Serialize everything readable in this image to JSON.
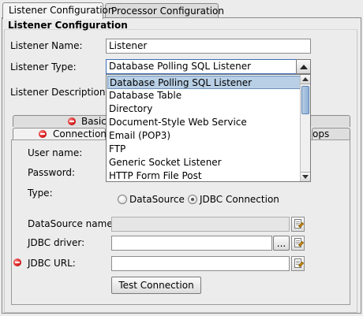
{
  "tabs": [
    {
      "label": "Listener Configuration"
    },
    {
      "label": "Processor Configuration"
    }
  ],
  "group_title": "Listener Configuration",
  "listener_name": {
    "label": "Listener Name:",
    "value": "Listener"
  },
  "listener_type": {
    "label": "Listener Type:",
    "value": "Database Polling SQL Listener",
    "options": [
      "Database Polling SQL Listener",
      "Database Table",
      "Directory",
      "Document-Style Web Service",
      "Email (POP3)",
      "FTP",
      "Generic Socket Listener",
      "HTTP Form File Post"
    ]
  },
  "listener_description": {
    "label": "Listener Description:"
  },
  "inner_tabs": {
    "basic": "Basic",
    "connection": "Connection",
    "props_partial": "ops"
  },
  "connection": {
    "user_name_label": "User name:",
    "password_label": "Password:",
    "type_label": "Type:",
    "type_options": [
      "DataSource",
      "JDBC Connection"
    ],
    "type_selected": "JDBC Connection",
    "datasource_label": "DataSource name:",
    "jdbc_driver_label": "JDBC driver:",
    "browse_label": "...",
    "jdbc_url_label": "JDBC URL:",
    "test_button": "Test Connection"
  }
}
